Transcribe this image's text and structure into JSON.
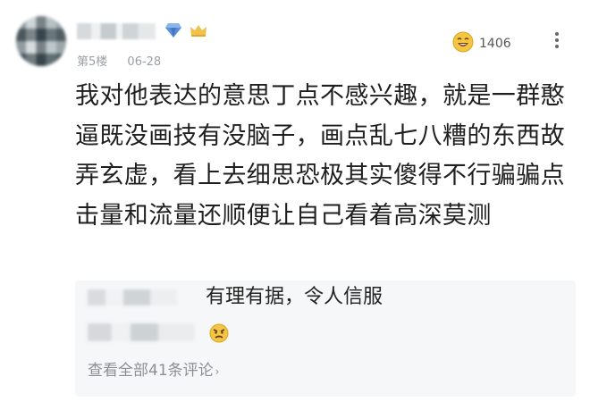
{
  "comment": {
    "floor": "第5楼",
    "date": "06-28",
    "like_count": "1406",
    "text": "我对他表达的意思丁点不感兴趣，就是一群憨逼既没画技有没脑子，画点乱七八糟的东西故弄玄虚，看上去细思恐极其实傻得不行骗骗点击量和流量还顺便让自己看着高深莫测"
  },
  "replies": {
    "items": [
      {
        "text": "有理有据，令人信服"
      }
    ],
    "view_all": "查看全部41条评论",
    "view_all_chevron": "›"
  },
  "icons": {
    "badge": "diamond-badge-icon",
    "vip": "crown-icon",
    "like": "laughing-emoji-icon",
    "more": "more-vertical-icon",
    "reply_emoji": "angry-emoji-icon"
  },
  "colors": {
    "gem": "#5b8fd6",
    "crown": "#f1c24b",
    "emoji": "#f4c542"
  }
}
